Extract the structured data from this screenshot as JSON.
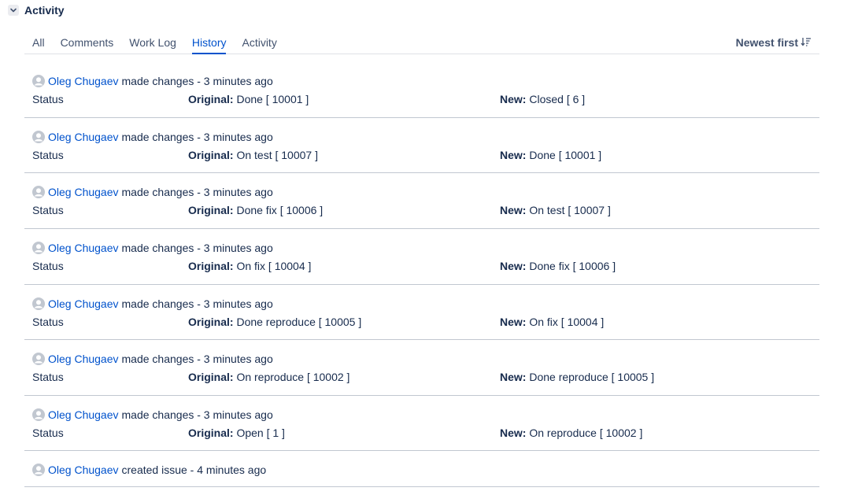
{
  "section": {
    "title": "Activity"
  },
  "tabs": [
    {
      "label": "All",
      "active": false
    },
    {
      "label": "Comments",
      "active": false
    },
    {
      "label": "Work Log",
      "active": false
    },
    {
      "label": "History",
      "active": true
    },
    {
      "label": "Activity",
      "active": false
    }
  ],
  "sort": {
    "label": "Newest first"
  },
  "labels": {
    "original": "Original:",
    "new": "New:"
  },
  "entries": [
    {
      "user": "Oleg Chugaev",
      "action": "made changes - 3 minutes ago",
      "field": "Status",
      "original": "Done [ 10001 ]",
      "new": "Closed [ 6 ]"
    },
    {
      "user": "Oleg Chugaev",
      "action": "made changes - 3 minutes ago",
      "field": "Status",
      "original": "On test [ 10007 ]",
      "new": "Done [ 10001 ]"
    },
    {
      "user": "Oleg Chugaev",
      "action": "made changes - 3 minutes ago",
      "field": "Status",
      "original": "Done fix [ 10006 ]",
      "new": "On test [ 10007 ]"
    },
    {
      "user": "Oleg Chugaev",
      "action": "made changes - 3 minutes ago",
      "field": "Status",
      "original": "On fix [ 10004 ]",
      "new": "Done fix [ 10006 ]"
    },
    {
      "user": "Oleg Chugaev",
      "action": "made changes - 3 minutes ago",
      "field": "Status",
      "original": "Done reproduce [ 10005 ]",
      "new": "On fix [ 10004 ]"
    },
    {
      "user": "Oleg Chugaev",
      "action": "made changes - 3 minutes ago",
      "field": "Status",
      "original": "On reproduce [ 10002 ]",
      "new": "Done reproduce [ 10005 ]"
    },
    {
      "user": "Oleg Chugaev",
      "action": "made changes - 3 minutes ago",
      "field": "Status",
      "original": "Open [ 1 ]",
      "new": "On reproduce [ 10002 ]"
    }
  ],
  "created": {
    "user": "Oleg Chugaev",
    "action": "created issue - 4 minutes ago"
  }
}
